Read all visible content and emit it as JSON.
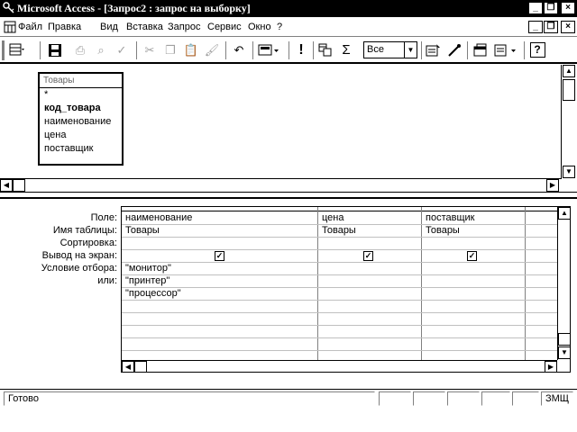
{
  "window": {
    "title": "Microsoft Access - [Запрос2 : запрос на выборку]",
    "controls": {
      "minimize": "_",
      "restore": "❐",
      "close": "×"
    }
  },
  "menu": {
    "items": [
      "Файл",
      "Правка",
      "Вид",
      "Вставка",
      "Запрос",
      "Сервис",
      "Окно",
      "?"
    ]
  },
  "toolbar": {
    "top_values_value": "Все",
    "icons": [
      "view-icon",
      "save-icon",
      "print-icon",
      "preview-icon",
      "spelling-icon",
      "cut-icon",
      "copy-icon",
      "paste-icon",
      "format-painter-icon",
      "undo-icon",
      "query-type-icon",
      "run-icon",
      "show-table-icon",
      "totals-icon",
      "properties-icon",
      "build-icon",
      "database-window-icon",
      "new-object-icon",
      "help-icon"
    ]
  },
  "table_box": {
    "title": "Товары",
    "fields": [
      "*",
      "код_товара",
      "наименование",
      "цена",
      "поставщик"
    ],
    "key_field": "код_товара"
  },
  "design_grid": {
    "row_labels": [
      "Поле:",
      "Имя таблицы:",
      "Сортировка:",
      "Вывод на экран:",
      "Условие отбора:",
      "или:"
    ],
    "columns": [
      {
        "field": "наименование",
        "table": "Товары",
        "sort": "",
        "show": true,
        "criteria": "\"монитор\"",
        "or": [
          "\"принтер\"",
          "\"процессор\""
        ]
      },
      {
        "field": "цена",
        "table": "Товары",
        "sort": "",
        "show": true,
        "criteria": "",
        "or": []
      },
      {
        "field": "поставщик",
        "table": "Товары",
        "sort": "",
        "show": true,
        "criteria": "",
        "or": []
      }
    ]
  },
  "status": {
    "message": "Готово",
    "indicator": "ЗМЩ"
  }
}
